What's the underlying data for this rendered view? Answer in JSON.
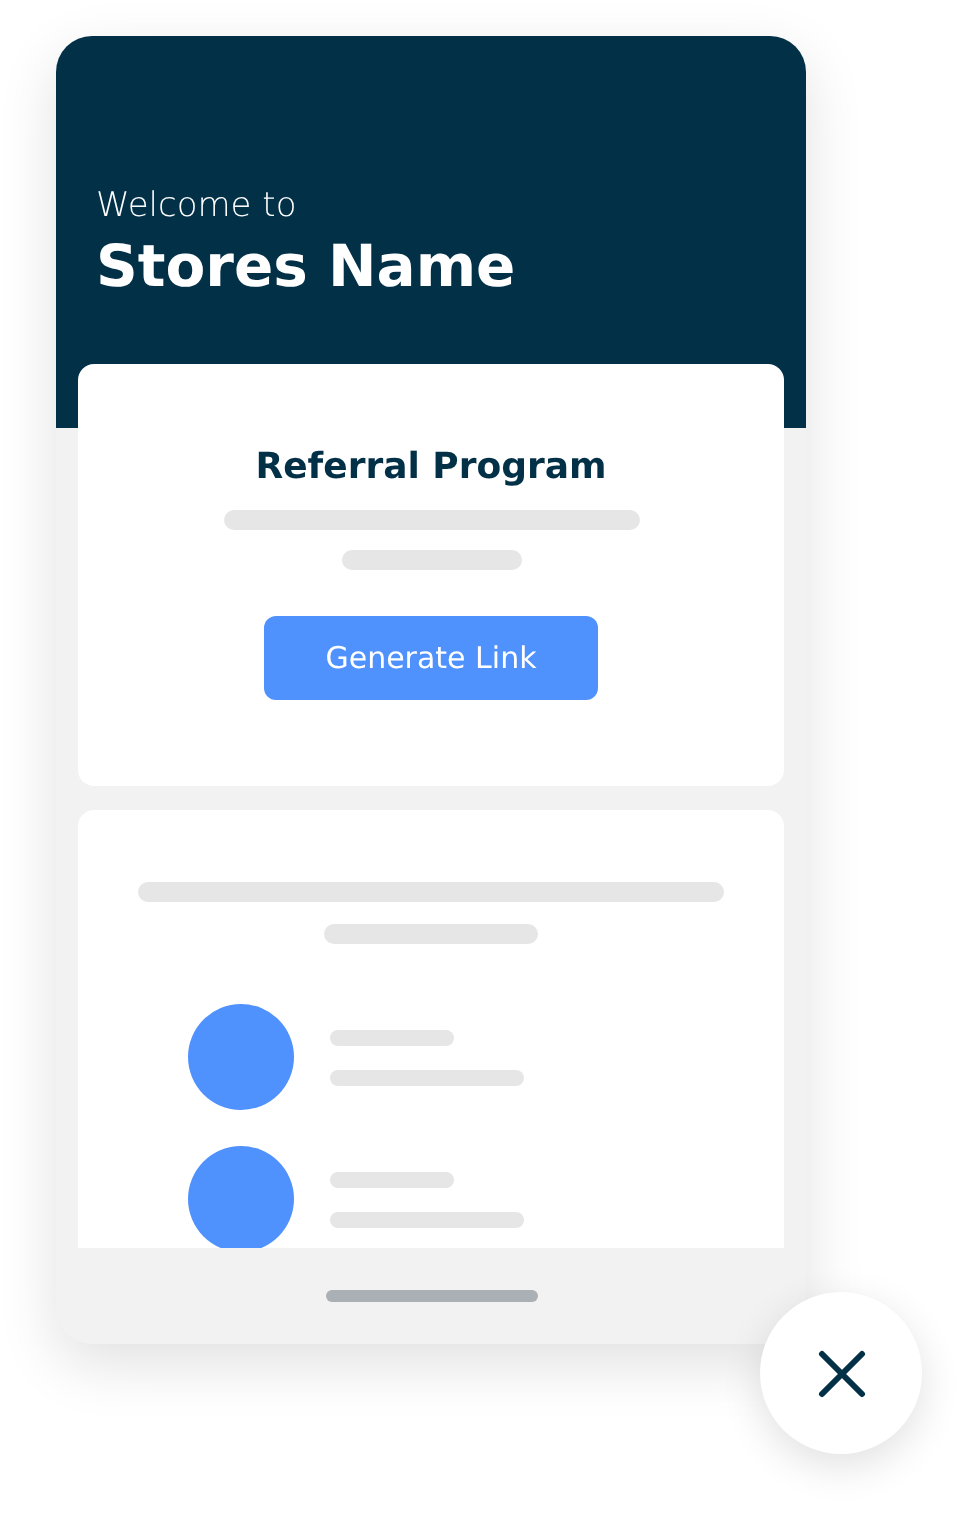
{
  "header": {
    "greeting": "Welcome to",
    "store_name": "Stores Name"
  },
  "referral_card": {
    "title": "Referral Program",
    "button": "Generate Link"
  }
}
